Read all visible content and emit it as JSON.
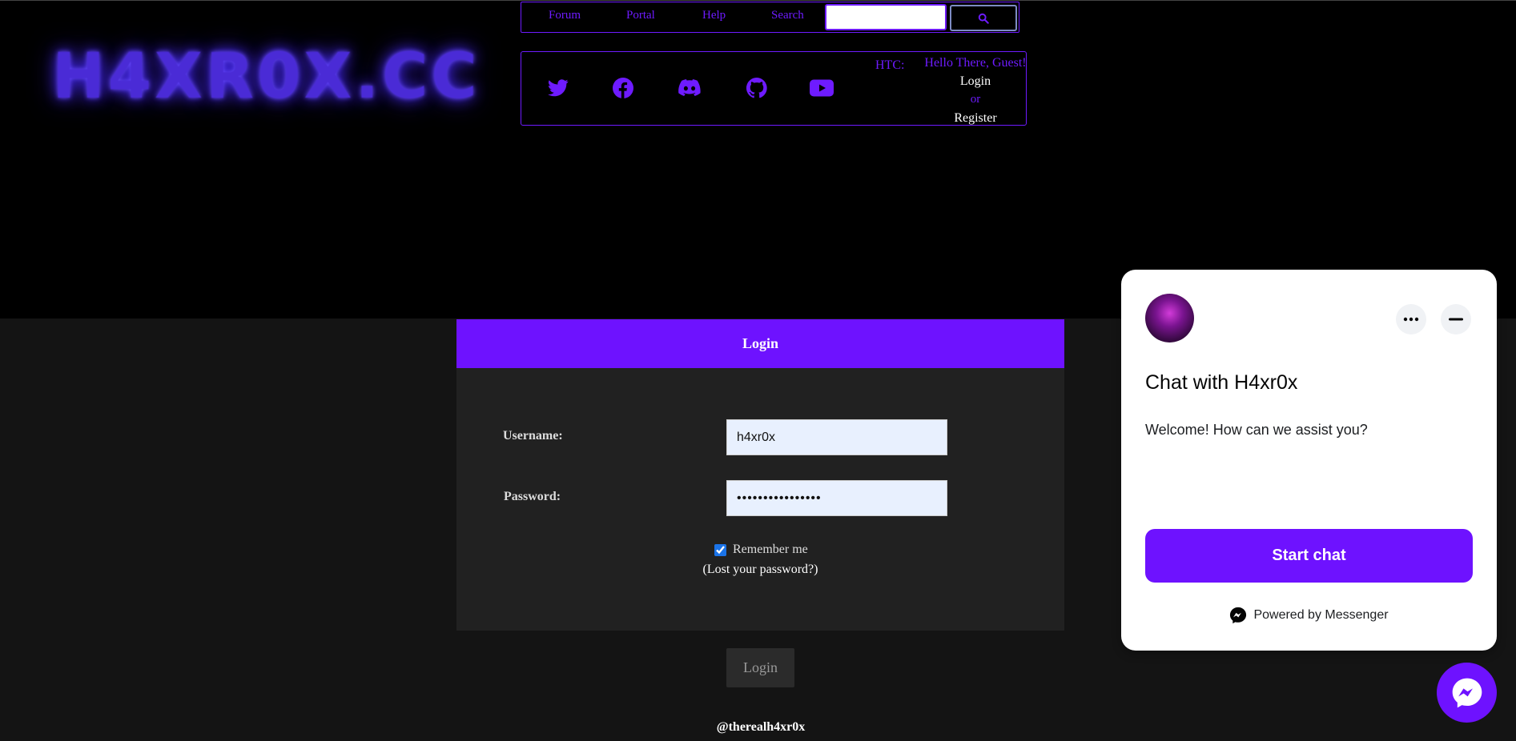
{
  "logo": {
    "text": "H4XR0X.CC"
  },
  "nav": {
    "items": [
      "Forum",
      "Portal",
      "Help",
      "Search"
    ],
    "search_placeholder": ""
  },
  "social": {
    "icons": [
      "twitter-icon",
      "facebook-icon",
      "discord-icon",
      "github-icon",
      "youtube-icon"
    ],
    "htc_label": "HTC:",
    "greeting": "Hello There, Guest!",
    "login_link": "Login",
    "or_text": "or",
    "register_link": "Register"
  },
  "login_form": {
    "header": "Login",
    "username_label": "Username:",
    "username_value": "h4xr0x",
    "password_label": "Password:",
    "password_value": "••••••••••••••••",
    "remember_label": "Remember me",
    "remember_checked": true,
    "lost_password": "(Lost your password?)",
    "submit_label": "Login"
  },
  "footer": {
    "handle": "@therealh4xr0x"
  },
  "chat_widget": {
    "title": "Chat with H4xr0x",
    "welcome": "Welcome! How can we assist you?",
    "start_button": "Start chat",
    "powered_by": "Powered by Messenger"
  },
  "colors": {
    "accent": "#6e12ff",
    "panel": "#212121",
    "page_bg": "#141414"
  }
}
